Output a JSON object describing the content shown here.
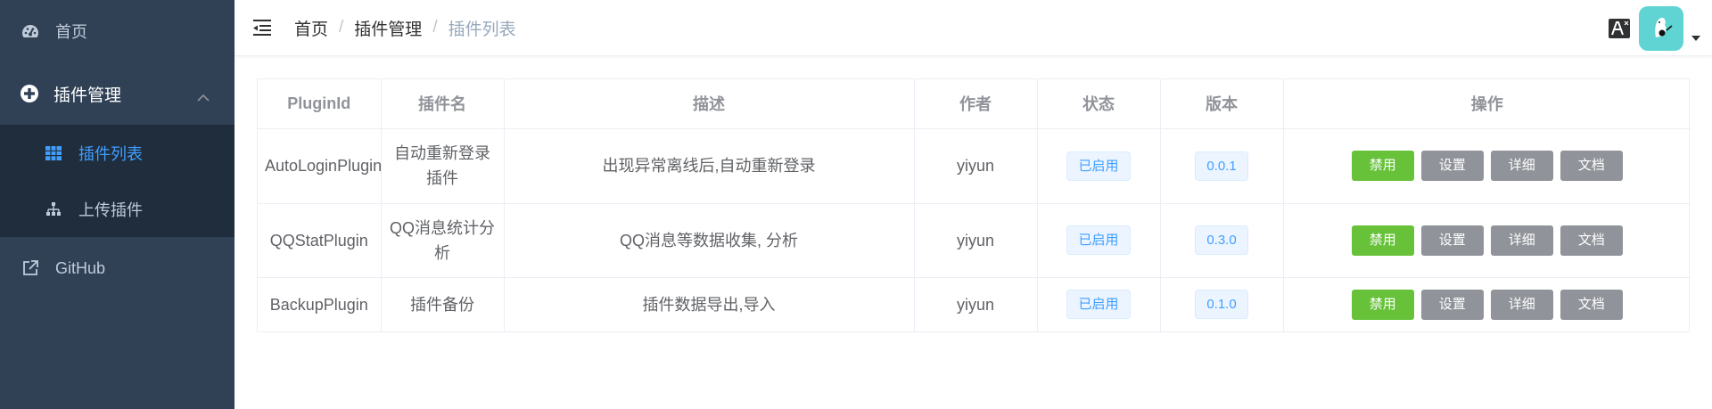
{
  "sidebar": {
    "home_label": "首页",
    "plugin_mgmt_label": "插件管理",
    "submenu": [
      {
        "label": "插件列表",
        "active": true
      },
      {
        "label": "上传插件",
        "active": false
      }
    ],
    "github_label": "GitHub"
  },
  "navbar": {
    "breadcrumb": [
      "首页",
      "插件管理",
      "插件列表"
    ],
    "breadcrumb_sep": "/"
  },
  "table": {
    "headers": [
      "PluginId",
      "插件名",
      "描述",
      "作者",
      "状态",
      "版本",
      "操作"
    ],
    "rows": [
      {
        "id": "AutoLoginPlugin",
        "name": "自动重新登录插件",
        "desc": "出现异常离线后,自动重新登录",
        "author": "yiyun",
        "status": "已启用",
        "version": "0.0.1"
      },
      {
        "id": "QQStatPlugin",
        "name": "QQ消息统计分析",
        "desc": "QQ消息等数据收集, 分析",
        "author": "yiyun",
        "status": "已启用",
        "version": "0.3.0"
      },
      {
        "id": "BackupPlugin",
        "name": "插件备份",
        "desc": "插件数据导出,导入",
        "author": "yiyun",
        "status": "已启用",
        "version": "0.1.0"
      }
    ],
    "actions": [
      "禁用",
      "设置",
      "详细",
      "文档"
    ]
  },
  "colors": {
    "sidebar_bg": "#304156",
    "submenu_bg": "#1f2d3d",
    "active": "#409eff",
    "green": "#67c23a",
    "gray": "#909399",
    "avatar_bg": "#5fd4d3"
  }
}
